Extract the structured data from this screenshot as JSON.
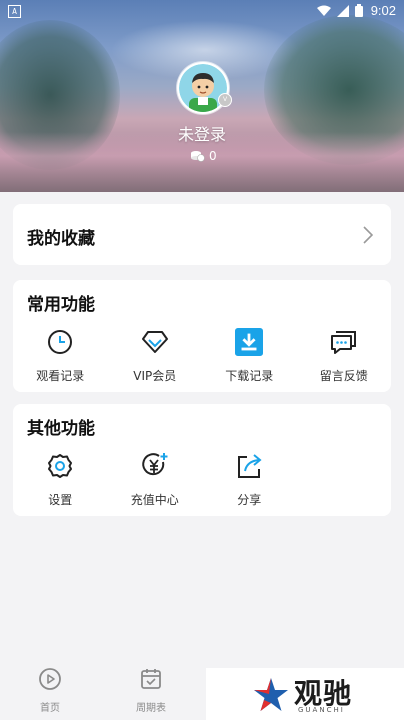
{
  "status_bar": {
    "time": "9:02",
    "notification_icon": "a-icon"
  },
  "profile": {
    "username": "未登录",
    "coins": "0"
  },
  "favorites": {
    "title": "我的收藏"
  },
  "common_functions": {
    "title": "常用功能",
    "items": [
      {
        "label": "观看记录",
        "icon": "clock-icon"
      },
      {
        "label": "VIP会员",
        "icon": "diamond-icon"
      },
      {
        "label": "下载记录",
        "icon": "download-icon"
      },
      {
        "label": "留言反馈",
        "icon": "message-icon"
      }
    ]
  },
  "other_functions": {
    "title": "其他功能",
    "items": [
      {
        "label": "设置",
        "icon": "gear-icon"
      },
      {
        "label": "充值中心",
        "icon": "recharge-icon"
      },
      {
        "label": "分享",
        "icon": "share-icon"
      }
    ]
  },
  "bottom_nav": [
    {
      "label": "首页",
      "icon": "play-icon"
    },
    {
      "label": "周期表",
      "icon": "calendar-icon"
    }
  ],
  "watermark": {
    "text": "观驰",
    "sub": "GUANCHI"
  },
  "colors": {
    "accent_blue": "#1aa3e8",
    "card_bg": "#ffffff",
    "page_bg": "#f3f3f5"
  }
}
